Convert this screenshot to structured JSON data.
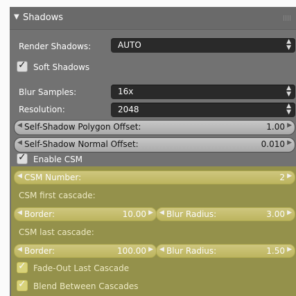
{
  "panel": {
    "header": {
      "title": "Shadows",
      "collapse_icon": "triangle-down-icon"
    },
    "render_shadows": {
      "label": "Render Shadows:",
      "value": "AUTO"
    },
    "soft_shadows": {
      "label": "Soft Shadows",
      "checked": true
    },
    "blur_samples": {
      "label": "Blur Samples:",
      "value": "16x"
    },
    "resolution": {
      "label": "Resolution:",
      "value": "2048"
    },
    "polygon_offset": {
      "label": "Self-Shadow Polygon Offset:",
      "value": "1.00"
    },
    "normal_offset": {
      "label": "Self-Shadow Normal Offset:",
      "value": "0.010"
    },
    "enable_csm": {
      "label": "Enable CSM",
      "checked": true
    },
    "csm_number": {
      "label": "CSM Number:",
      "value": "2"
    },
    "first_cascade": {
      "heading": "CSM first cascade:",
      "border": {
        "label": "Border:",
        "value": "10.00"
      },
      "blur_radius": {
        "label": "Blur Radius:",
        "value": "3.00"
      }
    },
    "last_cascade": {
      "heading": "CSM last cascade:",
      "border": {
        "label": "Border:",
        "value": "100.00"
      },
      "blur_radius": {
        "label": "Blur Radius:",
        "value": "1.50"
      }
    },
    "fade_out": {
      "label": "Fade-Out Last Cascade",
      "checked": true
    },
    "blend": {
      "label": "Blend Between Cascades",
      "checked": true
    },
    "highlight_color": "#d6ce00"
  }
}
